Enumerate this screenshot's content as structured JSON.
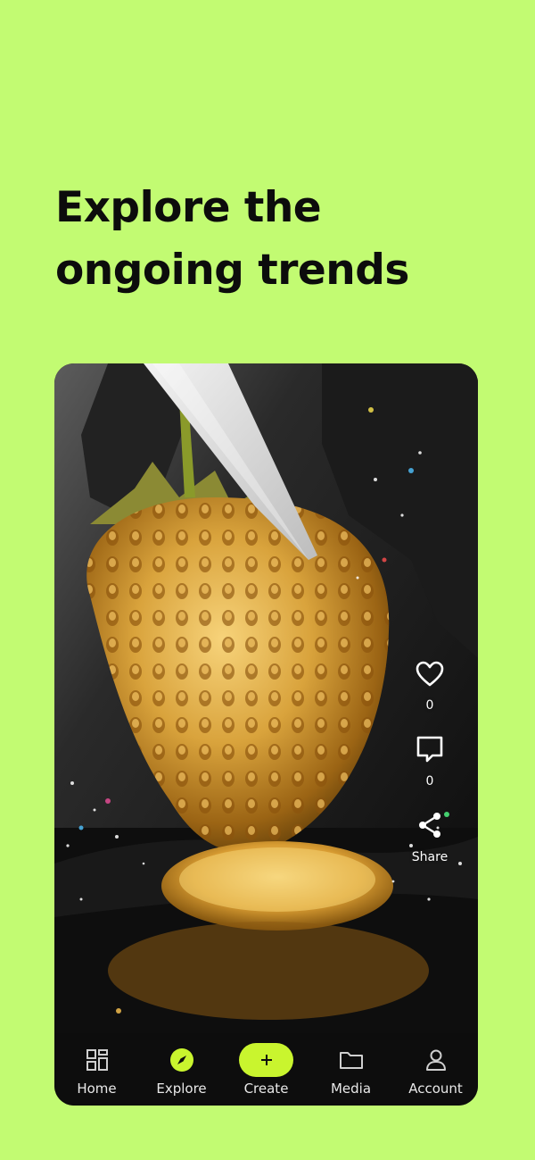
{
  "headline": {
    "line1": "Explore the",
    "line2": "ongoing trends"
  },
  "video": {
    "description_icon": "golden-strawberry-video",
    "actions": {
      "likes_count": "0",
      "comments_count": "0",
      "share_label": "Share"
    }
  },
  "tabbar": {
    "items": [
      {
        "label": "Home",
        "icon": "grid-icon"
      },
      {
        "label": "Explore",
        "icon": "compass-icon"
      },
      {
        "label": "Create",
        "icon": "plus-icon"
      },
      {
        "label": "Media",
        "icon": "folder-icon"
      },
      {
        "label": "Account",
        "icon": "user-icon"
      }
    ]
  },
  "colors": {
    "background": "#c2fb72",
    "accent": "#c9f52e",
    "tabbar": "#0d0d0d",
    "text": "#0c0c0c"
  }
}
